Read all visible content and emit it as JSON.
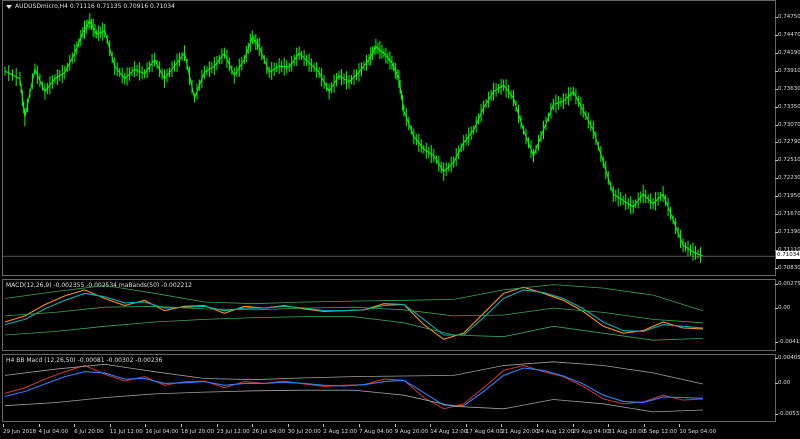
{
  "main_pane": {
    "title": "AUDUSDmicro,H4  0.71116 0.71135 0.70916 0.71034",
    "current_price": "0.71034",
    "y_labels": [
      "0.74750",
      "0.74470",
      "0.74190",
      "0.73910",
      "0.73630",
      "0.73350",
      "0.73070",
      "0.72790",
      "0.72510",
      "0.72230",
      "0.71950",
      "0.71670",
      "0.71390",
      "0.71110",
      "0.70830"
    ]
  },
  "macd_pane": {
    "title": "MACD(12,26,9) -0.002355 -0.002534  maBands(50) -0.002212",
    "y_labels": [
      "0.002759",
      "0.00",
      "-0.004156"
    ]
  },
  "bb_pane": {
    "title": "H4 BB Macd (12,26,50)  -0.00081 -0.00302 -0.00236",
    "y_labels": [
      "0.00405",
      "0.00",
      "-0.00533"
    ]
  },
  "x_axis": {
    "labels": [
      "29 Jun 2018",
      "4 Jul 04:00",
      "6 Jul 20:00",
      "11 Jul 12:00",
      "16 Jul 04:00",
      "18 Jul 20:00",
      "23 Jul 12:00",
      "26 Jul 04:00",
      "30 Jul 20:00",
      "2 Aug 12:00",
      "7 Aug 04:00",
      "9 Aug 20:00",
      "14 Aug 12:00",
      "17 Aug 04:00",
      "21 Aug 20:00",
      "24 Aug 12:00",
      "29 Aug 04:00",
      "31 Aug 20:00",
      "5 Sep 12:00",
      "10 Sep 04:00"
    ]
  },
  "chart_data": [
    {
      "type": "line",
      "title": "AUDUSDmicro,H4",
      "series": [
        {
          "name": "AUDUSDmicro",
          "color": "#00ff00",
          "x": [
            0,
            15,
            20,
            30,
            40,
            50,
            60,
            70,
            78,
            85,
            92,
            100,
            110,
            120,
            130,
            140,
            150,
            160,
            170,
            180,
            190,
            200,
            210,
            220,
            230,
            240,
            248,
            255,
            265,
            275,
            285,
            295,
            305,
            315,
            325,
            335,
            345,
            355,
            365,
            372,
            380,
            388,
            395,
            400,
            410,
            420,
            430,
            440,
            450,
            460,
            470,
            480,
            490,
            500,
            510,
            520,
            530,
            540,
            550,
            560,
            570,
            580,
            590,
            600,
            610,
            620,
            630,
            640,
            650,
            660,
            670,
            680,
            690,
            700
          ],
          "y": [
            0.7392,
            0.738,
            0.732,
            0.7395,
            0.736,
            0.738,
            0.739,
            0.742,
            0.7452,
            0.747,
            0.745,
            0.7455,
            0.74,
            0.738,
            0.7395,
            0.7388,
            0.741,
            0.738,
            0.74,
            0.742,
            0.735,
            0.739,
            0.74,
            0.742,
            0.7385,
            0.741,
            0.7445,
            0.743,
            0.739,
            0.74,
            0.7398,
            0.742,
            0.7405,
            0.739,
            0.736,
            0.7385,
            0.7375,
            0.739,
            0.741,
            0.743,
            0.742,
            0.7405,
            0.738,
            0.733,
            0.729,
            0.727,
            0.726,
            0.7235,
            0.725,
            0.728,
            0.73,
            0.7335,
            0.736,
            0.737,
            0.735,
            0.73,
            0.726,
            0.73,
            0.734,
            0.7345,
            0.736,
            0.733,
            0.73,
            0.725,
            0.72,
            0.719,
            0.718,
            0.72,
            0.7185,
            0.72,
            0.716,
            0.712,
            0.711,
            0.7103
          ]
        }
      ],
      "ylim": [
        0.7083,
        0.7489
      ]
    },
    {
      "type": "line",
      "title": "MACD(12,26,9)",
      "series": [
        {
          "name": "MACD",
          "color": "#ff8c1a",
          "x": [
            0,
            20,
            40,
            60,
            80,
            100,
            120,
            140,
            160,
            180,
            200,
            220,
            240,
            260,
            280,
            300,
            320,
            340,
            360,
            380,
            400,
            420,
            440,
            460,
            480,
            500,
            520,
            540,
            560,
            580,
            600,
            620,
            640,
            660,
            680,
            700
          ],
          "y": [
            -0.0015,
            -0.0008,
            0.0005,
            0.0015,
            0.0022,
            0.0012,
            0.0004,
            0.001,
            -0.0002,
            0.0003,
            0.0004,
            -0.0005,
            0.0003,
            0.0001,
            0.0004,
            0.0,
            -0.0003,
            -0.0002,
            -0.0001,
            0.0006,
            0.0005,
            -0.0018,
            -0.0035,
            -0.0028,
            -0.0005,
            0.0018,
            0.0025,
            0.0018,
            0.001,
            -0.0003,
            -0.002,
            -0.0028,
            -0.0025,
            -0.0015,
            -0.0022,
            -0.0023
          ]
        },
        {
          "name": "Signal",
          "color": "#00b0b0",
          "x": [
            0,
            20,
            40,
            60,
            80,
            100,
            120,
            140,
            160,
            180,
            200,
            220,
            240,
            260,
            280,
            300,
            320,
            340,
            360,
            380,
            400,
            420,
            440,
            460,
            480,
            500,
            520,
            540,
            560,
            580,
            600,
            620,
            640,
            660,
            680,
            700
          ],
          "y": [
            -0.0018,
            -0.0012,
            0.0,
            0.001,
            0.0018,
            0.0014,
            0.0007,
            0.0008,
            0.0001,
            0.0002,
            0.0003,
            -0.0002,
            0.0001,
            0.0001,
            0.0003,
            0.0001,
            -0.0002,
            -0.0002,
            -0.0001,
            0.0004,
            0.0005,
            -0.0012,
            -0.003,
            -0.003,
            -0.001,
            0.0012,
            0.0022,
            0.0019,
            0.0012,
            0.0,
            -0.0015,
            -0.0025,
            -0.0026,
            -0.0018,
            -0.002,
            -0.0022
          ]
        },
        {
          "name": "Upper band",
          "color": "#3aa35a",
          "x": [
            0,
            50,
            100,
            150,
            200,
            250,
            300,
            350,
            400,
            450,
            500,
            550,
            600,
            650,
            700
          ],
          "y": [
            0.0012,
            0.002,
            0.0027,
            0.0018,
            0.0008,
            0.0006,
            0.0008,
            0.0009,
            0.001,
            0.0011,
            0.0022,
            0.0028,
            0.0024,
            0.0016,
            -0.0002
          ]
        },
        {
          "name": "Middle band",
          "color": "#3aa35a",
          "x": [
            0,
            50,
            100,
            150,
            200,
            250,
            300,
            350,
            400,
            450,
            500,
            550,
            600,
            650,
            700
          ],
          "y": [
            -0.0008,
            -0.0004,
            0.0002,
            0.0003,
            0.0,
            -0.0001,
            0.0001,
            0.0002,
            -0.0001,
            -0.0008,
            -0.0007,
            0.0001,
            -0.0004,
            -0.0012,
            -0.0016
          ]
        },
        {
          "name": "Lower band",
          "color": "#3aa35a",
          "x": [
            0,
            50,
            100,
            150,
            200,
            250,
            300,
            350,
            400,
            450,
            500,
            550,
            600,
            650,
            700
          ],
          "y": [
            -0.003,
            -0.0026,
            -0.002,
            -0.0015,
            -0.0012,
            -0.001,
            -0.0009,
            -0.0009,
            -0.0016,
            -0.003,
            -0.0032,
            -0.002,
            -0.0028,
            -0.0036,
            -0.0034
          ]
        }
      ],
      "ylim": [
        -0.004156,
        0.002759
      ]
    },
    {
      "type": "line",
      "title": "H4 BB Macd (12,26,50)",
      "series": [
        {
          "name": "Macd",
          "color": "#c03030",
          "x": [
            0,
            20,
            40,
            60,
            80,
            100,
            120,
            140,
            160,
            180,
            200,
            220,
            240,
            260,
            280,
            300,
            320,
            340,
            360,
            380,
            400,
            420,
            440,
            460,
            480,
            500,
            520,
            540,
            560,
            580,
            600,
            620,
            640,
            660,
            680,
            700
          ],
          "y": [
            -0.0015,
            -0.0006,
            0.0008,
            0.002,
            0.003,
            0.0016,
            0.0005,
            0.0012,
            -0.0002,
            0.0004,
            0.0005,
            -0.0006,
            0.0004,
            0.0001,
            0.0005,
            0.0,
            -0.0004,
            -0.0002,
            -0.0001,
            0.0008,
            0.0006,
            -0.0022,
            -0.004,
            -0.0032,
            -0.0006,
            0.0022,
            0.003,
            0.002,
            0.0012,
            -0.0004,
            -0.0024,
            -0.0032,
            -0.0029,
            -0.0018,
            -0.0026,
            -0.0024
          ]
        },
        {
          "name": "Signal",
          "color": "#2a7fff",
          "x": [
            0,
            20,
            40,
            60,
            80,
            100,
            120,
            140,
            160,
            180,
            200,
            220,
            240,
            260,
            280,
            300,
            320,
            340,
            360,
            380,
            400,
            420,
            440,
            460,
            480,
            500,
            520,
            540,
            560,
            580,
            600,
            620,
            640,
            660,
            680,
            700
          ],
          "y": [
            -0.002,
            -0.0012,
            0.0,
            0.0012,
            0.002,
            0.0018,
            0.0008,
            0.0009,
            0.0001,
            0.0002,
            0.0004,
            -0.0002,
            0.0001,
            0.0001,
            0.0003,
            0.0001,
            -0.0002,
            -0.0003,
            -0.0001,
            0.0004,
            0.0006,
            -0.0014,
            -0.0034,
            -0.0035,
            -0.0012,
            0.0014,
            0.0026,
            0.0022,
            0.0013,
            0.0,
            -0.0018,
            -0.0028,
            -0.003,
            -0.0021,
            -0.0022,
            -0.0023
          ]
        },
        {
          "name": "Upper band",
          "color": "#a0a0a0",
          "x": [
            0,
            50,
            100,
            150,
            200,
            250,
            300,
            350,
            400,
            450,
            500,
            550,
            600,
            650,
            700
          ],
          "y": [
            0.0014,
            0.0024,
            0.0032,
            0.002,
            0.0009,
            0.0007,
            0.001,
            0.0012,
            0.0013,
            0.0014,
            0.003,
            0.0036,
            0.003,
            0.0018,
            0.0
          ]
        },
        {
          "name": "Lower band",
          "color": "#a0a0a0",
          "x": [
            0,
            50,
            100,
            150,
            200,
            250,
            300,
            350,
            400,
            450,
            500,
            550,
            600,
            650,
            700
          ],
          "y": [
            -0.0035,
            -0.003,
            -0.0022,
            -0.0016,
            -0.0013,
            -0.0011,
            -0.001,
            -0.001,
            -0.0018,
            -0.0036,
            -0.004,
            -0.0025,
            -0.0032,
            -0.0045,
            -0.0042
          ]
        }
      ],
      "ylim": [
        -0.00533,
        0.00405
      ]
    }
  ]
}
